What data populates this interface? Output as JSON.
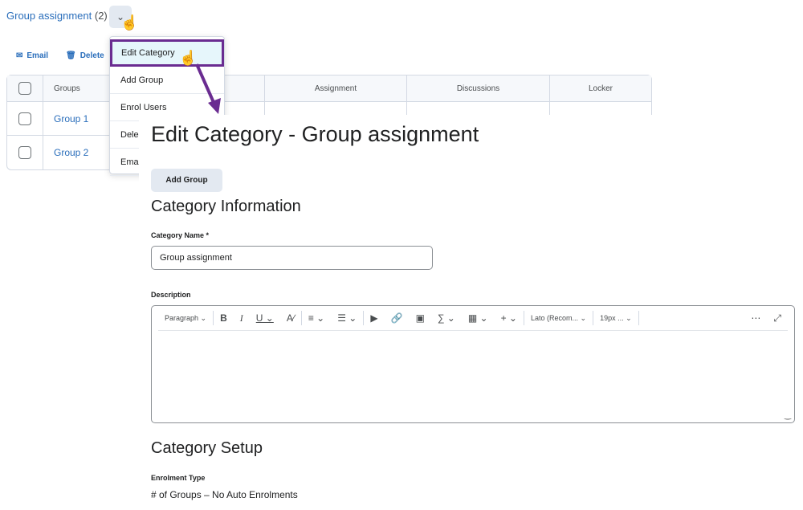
{
  "category": {
    "title": "Group assignment",
    "count": "(2)"
  },
  "toolbar": {
    "email": "Email",
    "delete": "Delete"
  },
  "table": {
    "headers": [
      "Groups",
      "Assignment",
      "Discussions",
      "Locker"
    ],
    "rows": [
      "Group 1",
      "Group 2"
    ]
  },
  "menu": {
    "items": [
      "Edit Category",
      "Add Group",
      "Enrol Users",
      "Dele",
      "Emai"
    ]
  },
  "panel": {
    "title": "Edit Category - Group assignment",
    "add_group": "Add Group",
    "info_heading": "Category Information",
    "name_label": "Category Name *",
    "name_value": "Group assignment",
    "description_label": "Description",
    "editor": {
      "paragraph": "Paragraph",
      "font": "Lato (Recom...",
      "size": "19px ..."
    },
    "setup_heading": "Category Setup",
    "enrolment_label": "Enrolment Type",
    "enrolment_value": "# of Groups – No Auto Enrolments"
  },
  "colors": {
    "accent": "#6a2c91",
    "link": "#2a6ebb"
  }
}
